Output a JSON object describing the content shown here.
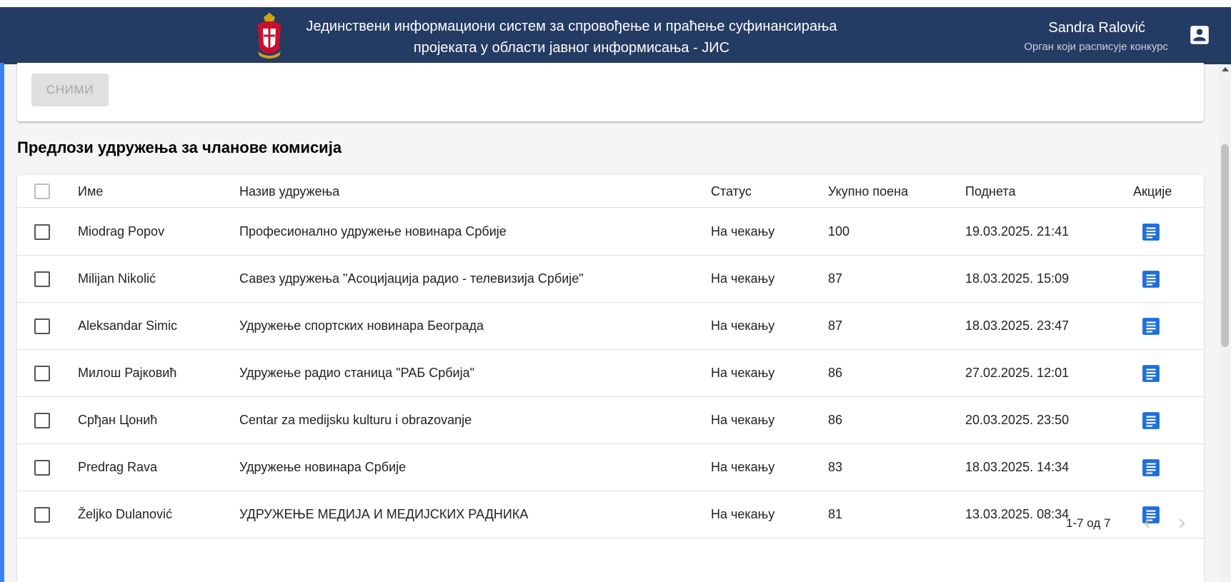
{
  "header": {
    "title_line1": "Јединствени информациони систем за спровођење и праћење суфинансирања",
    "title_line2": "пројеката у области јавног информисања - ЈИС",
    "user_name": "Sandra Ralović",
    "user_role": "Орган који расписује конкурс"
  },
  "form": {
    "save_label": "СНИМИ"
  },
  "table": {
    "title": "Предлози удружења за чланове комисија",
    "columns": {
      "name": "Име",
      "association": "Назив удружења",
      "status": "Статус",
      "points": "Укупно поена",
      "submitted": "Поднета",
      "actions": "Акције"
    },
    "rows": [
      {
        "name": "Miodrag Popov",
        "association": "Професионално удружење новинара Србије",
        "status": "На чекању",
        "points": "100",
        "submitted": "19.03.2025. 21:41"
      },
      {
        "name": "Milijan Nikolić",
        "association": "Савез удружења \"Асоцијација радио - телевизија Србије\"",
        "status": "На чекању",
        "points": "87",
        "submitted": "18.03.2025. 15:09"
      },
      {
        "name": "Aleksandar Simic",
        "association": "Удружење спортских новинара Београда",
        "status": "На чекању",
        "points": "87",
        "submitted": "18.03.2025. 23:47"
      },
      {
        "name": "Милош Рајковић",
        "association": "Удружење радио станица \"РАБ Србија\"",
        "status": "На чекању",
        "points": "86",
        "submitted": "27.02.2025. 12:01"
      },
      {
        "name": "Срђан Цонић",
        "association": "Centar za medijsku kulturu i obrazovanje",
        "status": "На чекању",
        "points": "86",
        "submitted": "20.03.2025. 23:50"
      },
      {
        "name": "Predrag Rava",
        "association": "Удружење новинара Србије",
        "status": "На чекању",
        "points": "83",
        "submitted": "18.03.2025. 14:34"
      },
      {
        "name": "Željko Dulanović",
        "association": "УДРУЖЕЊЕ МЕДИЈА И МЕДИЈСКИХ РАДНИКА",
        "status": "На чекању",
        "points": "81",
        "submitted": "13.03.2025. 08:34"
      }
    ],
    "pagination": "1-7 од 7"
  },
  "colors": {
    "header_bg": "#243b63",
    "accent": "#1e6fd9",
    "left_accent": "#3b82f6"
  },
  "icons": {
    "emblem": "serbian-coat-of-arms",
    "account": "account-box-icon",
    "action": "description-icon",
    "prev": "chevron-left-icon",
    "next": "chevron-right-icon"
  }
}
